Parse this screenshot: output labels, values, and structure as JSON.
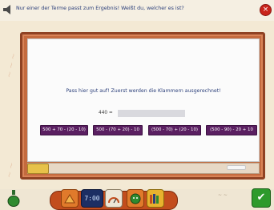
{
  "header": {
    "instruction": "Nur einer der Terme passt zum Ergebnis! Weißt du, welcher es ist?",
    "close_symbol": "×"
  },
  "board": {
    "hint": "Pass hier gut auf! Zuerst werden die Klammern ausgerechnet!",
    "answer_label": "440 =",
    "answer_value": "",
    "options": [
      "500 + 70 - (20 - 10)",
      "500 - (70 + 20) - 10",
      "(500 - 70) + (20 - 10)",
      "(500 - 90) - 20 + 10"
    ]
  },
  "toolbar": {
    "clock_text": "7:00",
    "ok_symbol": "✔"
  },
  "colors": {
    "option_bg": "#5a1f61",
    "board_frame": "#c46a3e",
    "text_blue": "#2b3f7a"
  }
}
